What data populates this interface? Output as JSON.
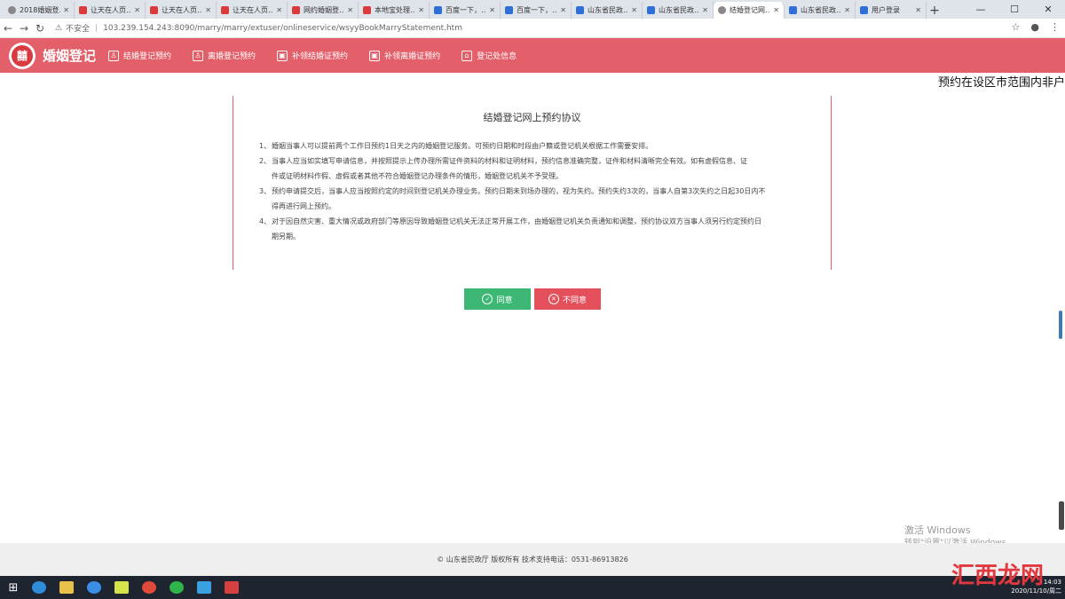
{
  "browser": {
    "tabs": [
      {
        "title": "2018婚姻登…",
        "icon": "page-icon"
      },
      {
        "title": "让天在人页…",
        "icon": "app-icon"
      },
      {
        "title": "让天在人页…",
        "icon": "app-icon"
      },
      {
        "title": "让天在人页…",
        "icon": "app-icon"
      },
      {
        "title": "网约婚姻登…",
        "icon": "app-icon"
      },
      {
        "title": "本地宝处理…",
        "icon": "app-icon"
      },
      {
        "title": "百度一下，…",
        "icon": "paw-icon"
      },
      {
        "title": "百度一下，…",
        "icon": "paw-icon"
      },
      {
        "title": "山东省民政…",
        "icon": "gov-icon"
      },
      {
        "title": "山东省民政…",
        "icon": "gov-icon"
      },
      {
        "title": "结婚登记网…",
        "icon": "globe-icon",
        "active": true
      },
      {
        "title": "山东省民政…",
        "icon": "gov-icon"
      },
      {
        "title": "用户登录",
        "icon": "gov-icon"
      }
    ],
    "security_label": "不安全",
    "url": "103.239.154.243:8090/marry/marry/extuser/onlineservice/wsyyBookMarryStatement.htm"
  },
  "header": {
    "logo_glyph": "囍",
    "brand": "婚姻登记",
    "menu": [
      {
        "label": "结婚登记预约",
        "icon": "person-icon"
      },
      {
        "label": "离婚登记预约",
        "icon": "person-icon"
      },
      {
        "label": "补领结婚证预约",
        "icon": "certificate-icon"
      },
      {
        "label": "补领离婚证预约",
        "icon": "certificate-icon"
      },
      {
        "label": "登记处信息",
        "icon": "home-icon"
      }
    ]
  },
  "marquee": "预约在设区市范围内非户",
  "agreement": {
    "title": "结婚登记网上预约协议",
    "items": [
      {
        "num": "1、",
        "text": "婚姻当事人可以提前两个工作日预约1日天之内的婚姻登记服务。可预约日期和时段由户籍或登记机关根据工作需要安排。"
      },
      {
        "num": "2、",
        "text": "当事人应当如实填写申请信息，并按照提示上传办理所需证件资料的材料和证明材料，预约信息准确完整，证件和材料清晰完全有效。如有虚假信息、证"
      },
      {
        "num": "",
        "text": "件或证明材料作假、虚假或者其他不符合婚姻登记办理条件的情形，婚姻登记机关不予受理。"
      },
      {
        "num": "3、",
        "text": "预约申请提交后，当事人应当按照约定的时间到登记机关办理业务。预约日期未到场办理的，视为失约。预约失约3次的，当事人自第3次失约之日起30日内不"
      },
      {
        "num": "",
        "text": "得再进行网上预约。"
      },
      {
        "num": "4、",
        "text": "对于因自然灾害、重大情况或政府部门等原因导致婚姻登记机关无法正常开展工作，由婚姻登记机关负责通知和调整，预约协议双方当事人须另行约定预约日"
      },
      {
        "num": "",
        "text": "期另期。"
      }
    ],
    "agree_label": "同意",
    "disagree_label": "不同意"
  },
  "footer": {
    "text": "© 山东省民政厅 版权所有    技术支持电话：0531-86913826"
  },
  "activation": {
    "line1": "激活 Windows",
    "line2": "转到\"设置\"以激活 Windows。"
  },
  "taskbar": {
    "time": "14:03",
    "date": "2020/11/10/周二"
  },
  "watermark": "汇西龙网",
  "colors": {
    "brand": "#e3606a",
    "agree": "#3cb874",
    "disagree": "#e3505c"
  }
}
